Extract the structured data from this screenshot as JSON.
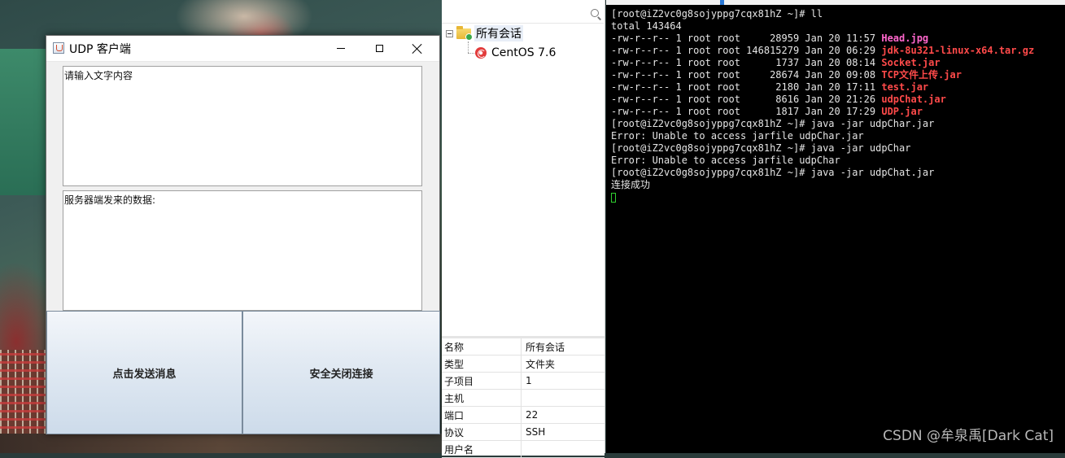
{
  "udp_window": {
    "title": "UDP 客户端",
    "input_placeholder": "请输入文字内容",
    "server_data_label": "服务器端发来的数据:",
    "send_button": "点击发送消息",
    "close_button": "安全关闭连接"
  },
  "session_tree": {
    "root_label": "所有会话",
    "child_label": "CentOS 7.6"
  },
  "properties": [
    {
      "key": "名称",
      "value": "所有会话"
    },
    {
      "key": "类型",
      "value": "文件夹"
    },
    {
      "key": "子项目",
      "value": "1"
    },
    {
      "key": "主机",
      "value": ""
    },
    {
      "key": "端口",
      "value": "22"
    },
    {
      "key": "协议",
      "value": "SSH"
    },
    {
      "key": "用户名",
      "value": ""
    }
  ],
  "terminal": {
    "lines": [
      "[root@iZ2vc0g8sojyppg7cqx81hZ ~]# ll",
      "total 143464"
    ],
    "listing": [
      {
        "meta": "-rw-r--r-- 1 root root     28959 Jan 20 11:57 ",
        "name": "Head.jpg",
        "color": "#ff66cc"
      },
      {
        "meta": "-rw-r--r-- 1 root root 146815279 Jan 20 06:29 ",
        "name": "jdk-8u321-linux-x64.tar.gz",
        "color": "#ff4a4a"
      },
      {
        "meta": "-rw-r--r-- 1 root root      1737 Jan 20 08:14 ",
        "name": "Socket.jar",
        "color": "#ff4a4a"
      },
      {
        "meta": "-rw-r--r-- 1 root root     28674 Jan 20 09:08 ",
        "name": "TCP文件上传.jar",
        "color": "#ff4a4a"
      },
      {
        "meta": "-rw-r--r-- 1 root root      2180 Jan 20 17:11 ",
        "name": "test.jar",
        "color": "#ff4a4a"
      },
      {
        "meta": "-rw-r--r-- 1 root root      8616 Jan 20 21:26 ",
        "name": "udpChat.jar",
        "color": "#ff4a4a"
      },
      {
        "meta": "-rw-r--r-- 1 root root      1817 Jan 20 17:29 ",
        "name": "UDP.jar",
        "color": "#ff4a4a"
      }
    ],
    "after": [
      "[root@iZ2vc0g8sojyppg7cqx81hZ ~]# java -jar udpChar.jar",
      "Error: Unable to access jarfile udpChar.jar",
      "[root@iZ2vc0g8sojyppg7cqx81hZ ~]# java -jar udpChar",
      "Error: Unable to access jarfile udpChar",
      "[root@iZ2vc0g8sojyppg7cqx81hZ ~]# java -jar udpChat.jar",
      "连接成功"
    ],
    "cursor_color": "#2fd02f"
  },
  "watermark": "CSDN @牟泉禹[Dark Cat]"
}
